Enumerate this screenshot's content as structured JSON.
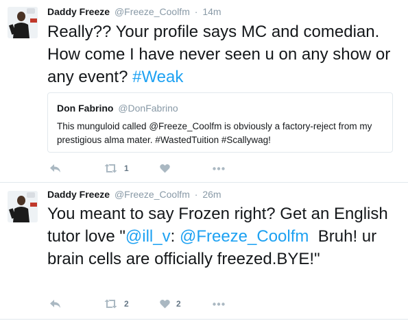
{
  "tweets": [
    {
      "author_name": "Daddy Freeze",
      "author_handle": "@Freeze_Coolfm",
      "separator": "·",
      "timestamp": "14m",
      "text_before": "Really?? Your profile says MC and comedian. How come I have never seen u on any show or any event? ",
      "hashtag": "#Weak",
      "quoted": {
        "author_name": "Don Fabrino",
        "author_handle": "@DonFabrino",
        "text": "This munguloid called @Freeze_Coolfm is obviously a factory-reject from my prestigious alma mater. #WastedTuition #Scallywag!"
      },
      "retweet_count": "1",
      "like_count": ""
    },
    {
      "author_name": "Daddy Freeze",
      "author_handle": "@Freeze_Coolfm",
      "separator": "·",
      "timestamp": "26m",
      "text_before": "You meant to say Frozen right? Get an English tutor love \"",
      "mention_1": "@ill_v",
      "text_middle": ": ",
      "mention_2": "@Freeze_Coolfm",
      "text_after": "  Bruh! ur brain cells are officially freezed.BYE!\"",
      "retweet_count": "2",
      "like_count": "2"
    }
  ],
  "icons": {
    "reply": "reply-icon",
    "retweet": "retweet-icon",
    "like": "heart-icon",
    "more": "more-icon",
    "avatar": "avatar-photo"
  },
  "colors": {
    "link": "#1da1f2",
    "meta": "#8899a6",
    "action_icon": "#aab8c2",
    "divider": "#e1e8ed"
  }
}
